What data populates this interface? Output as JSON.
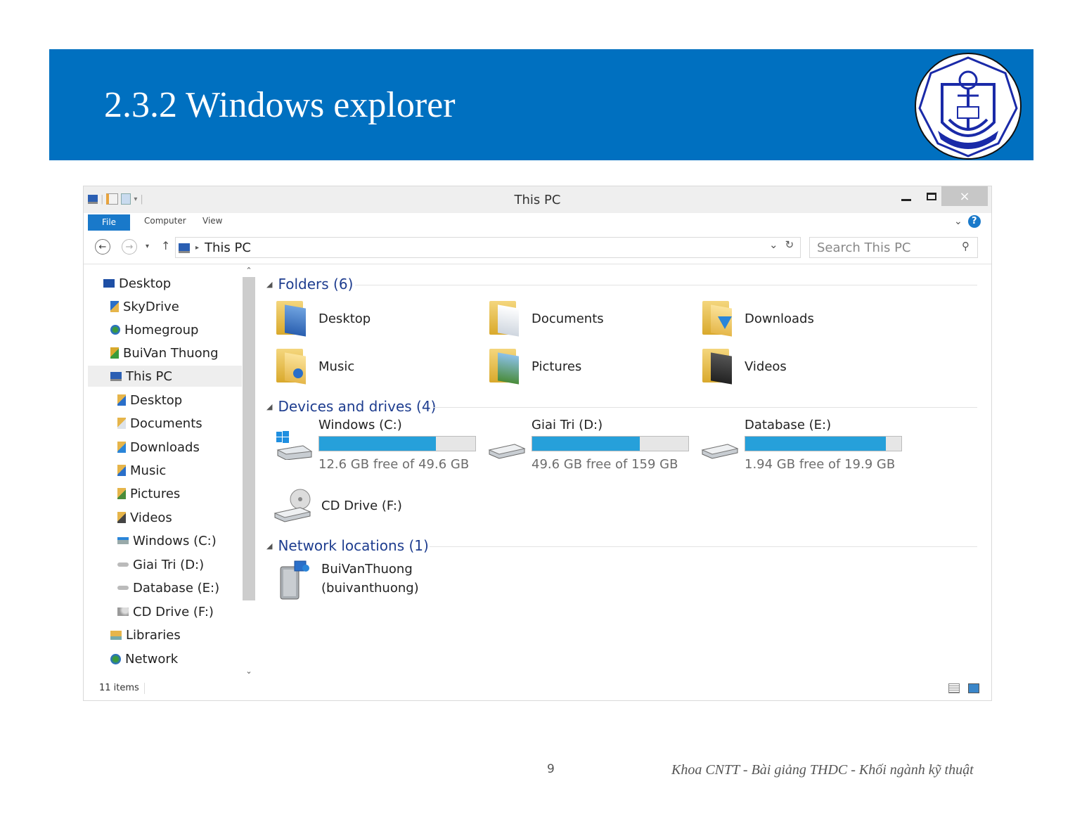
{
  "slide": {
    "title": "2.3.2 Windows explorer",
    "page_number": "9",
    "footer": "Khoa CNTT - Bài giảng THDC - Khối ngành kỹ thuật",
    "header_color": "#0070c0"
  },
  "window": {
    "title": "This PC",
    "close_label": "×",
    "ribbon": {
      "file": "File",
      "computer": "Computer",
      "view": "View"
    },
    "address": {
      "crumb": "This PC",
      "search_placeholder": "Search This PC"
    },
    "status": {
      "items": "11 items"
    }
  },
  "nav_pane": {
    "items": [
      {
        "label": "Desktop",
        "icon": "desktop-icon"
      },
      {
        "label": "SkyDrive",
        "icon": "skydrive-icon"
      },
      {
        "label": "Homegroup",
        "icon": "homegroup-icon"
      },
      {
        "label": "BuiVan Thuong",
        "icon": "user-icon"
      },
      {
        "label": "This PC",
        "icon": "computer-icon",
        "selected": true
      },
      {
        "label": "Desktop",
        "icon": "desktop-folder-icon"
      },
      {
        "label": "Documents",
        "icon": "documents-icon"
      },
      {
        "label": "Downloads",
        "icon": "downloads-icon"
      },
      {
        "label": "Music",
        "icon": "music-icon"
      },
      {
        "label": "Pictures",
        "icon": "pictures-icon"
      },
      {
        "label": "Videos",
        "icon": "videos-icon"
      },
      {
        "label": "Windows (C:)",
        "icon": "windows-drive-icon"
      },
      {
        "label": "Giai Tri (D:)",
        "icon": "drive-icon"
      },
      {
        "label": "Database (E:)",
        "icon": "drive-icon"
      },
      {
        "label": "CD Drive (F:)",
        "icon": "cd-drive-icon"
      },
      {
        "label": "Libraries",
        "icon": "libraries-icon"
      },
      {
        "label": "Network",
        "icon": "network-icon"
      }
    ]
  },
  "groups": {
    "folders": "Folders (6)",
    "devices": "Devices and drives (4)",
    "network": "Network locations (1)"
  },
  "folders": [
    {
      "name": "Desktop",
      "icon": "desktop-folder-icon"
    },
    {
      "name": "Documents",
      "icon": "documents-folder-icon"
    },
    {
      "name": "Downloads",
      "icon": "downloads-folder-icon"
    },
    {
      "name": "Music",
      "icon": "music-folder-icon"
    },
    {
      "name": "Pictures",
      "icon": "pictures-folder-icon"
    },
    {
      "name": "Videos",
      "icon": "videos-folder-icon"
    }
  ],
  "drives": [
    {
      "name": "Windows (C:)",
      "free": "12.6 GB free of 49.6 GB",
      "used_fraction": 0.746,
      "icon": "windows-drive-icon"
    },
    {
      "name": "Giai Tri (D:)",
      "free": "49.6 GB free of 159 GB",
      "used_fraction": 0.688,
      "icon": "hard-drive-icon"
    },
    {
      "name": "Database (E:)",
      "free": "1.94 GB free of 19.9 GB",
      "used_fraction": 0.902,
      "icon": "hard-drive-icon"
    }
  ],
  "cd_drive": {
    "name": "CD Drive (F:)",
    "icon": "cd-drive-icon"
  },
  "network_location": {
    "line1": "BuiVanThuong",
    "line2": "(buivanthuong)",
    "icon": "network-media-icon"
  },
  "colors": {
    "accent": "#1979ca",
    "drive_bar": "#26a0da",
    "group_header": "#1e3d8f"
  }
}
